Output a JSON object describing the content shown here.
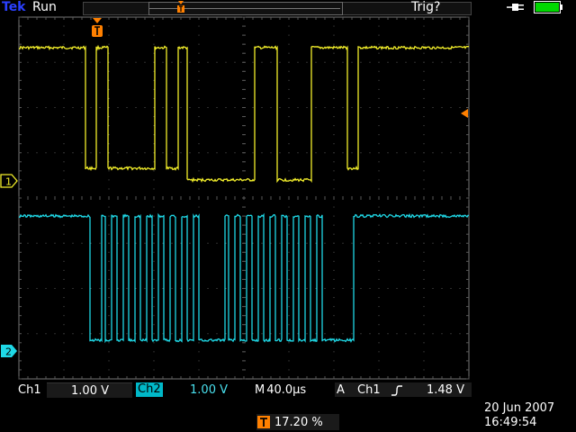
{
  "header": {
    "brand": "Tek",
    "acq_state": "Run",
    "trigger_status": "Trig?"
  },
  "channels": [
    {
      "name": "Ch1",
      "marker": "1",
      "scale": "1.00 V",
      "color": "#f2ee2a"
    },
    {
      "name": "Ch2",
      "marker": "2",
      "scale": "1.00 V",
      "color": "#1fd8e6"
    }
  ],
  "trigger": {
    "marker": "T",
    "mode_letter": "A",
    "source": "Ch1",
    "slope_icon": "rising-edge-icon",
    "level": "1.48 V",
    "position": "17.20 %"
  },
  "timebase": {
    "prefix": "M",
    "value": "40.0µs"
  },
  "datetime": {
    "date": "20 Jun  2007",
    "time": "16:49:54"
  },
  "icons": {
    "power": "ac-power-plug-icon",
    "battery": "battery-icon"
  },
  "colors": {
    "ch1": "#f2ee2a",
    "ch2": "#1fd8e6",
    "trigger": "#ff8000",
    "grid": "#5a5a5a"
  }
}
